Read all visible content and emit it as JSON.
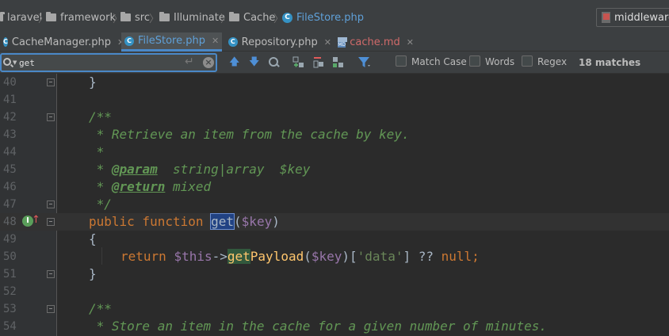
{
  "breadcrumbs": [
    {
      "label": "laravel",
      "icon": "folder-icon"
    },
    {
      "label": "framework",
      "icon": "folder-icon"
    },
    {
      "label": "src",
      "icon": "folder-icon"
    },
    {
      "label": "Illuminate",
      "icon": "folder-icon"
    },
    {
      "label": "Cache",
      "icon": "folder-icon"
    },
    {
      "label": "FileStore.php",
      "icon": "class-icon"
    }
  ],
  "run_config": {
    "label": "middleware"
  },
  "tabs": [
    {
      "label": "CacheManager.php",
      "active": false
    },
    {
      "label": "FileStore.php",
      "active": true
    },
    {
      "label": "Repository.php",
      "active": false
    },
    {
      "label": "cache.md",
      "active": false
    }
  ],
  "class_icon_letter": "C",
  "md_icon_text": "MD",
  "search": {
    "value": "get",
    "options": [
      {
        "label": "Match Case",
        "checked": false
      },
      {
        "label": "Words",
        "checked": false
      },
      {
        "label": "Regex",
        "checked": false
      }
    ],
    "matches": "18 matches",
    "icons": [
      "prev-occurrence-icon",
      "next-occurrence-icon",
      "find-all-icon",
      "add-selection-icon",
      "remove-selection-icon",
      "select-all-icon",
      "filter-icon"
    ]
  },
  "colors": {
    "keyword": "#cc7832",
    "doc_comment": "#629755",
    "variable": "#9876aa",
    "string": "#6a8759",
    "function": "#ffc66d",
    "search_highlight": "#214283",
    "active_tab": "#5fa0d8"
  },
  "editor": {
    "gutter_marker": {
      "line": "48",
      "icon": "implements-method-icon",
      "badge": "I",
      "arrow": "↑"
    },
    "lines": [
      {
        "num": "40",
        "t1": "    }"
      },
      {
        "num": "41",
        "t1": ""
      },
      {
        "num": "42",
        "t1": "/**"
      },
      {
        "num": "43",
        "t1": " * Retrieve an item from the cache by key."
      },
      {
        "num": "44",
        "t1": " *"
      },
      {
        "num": "45",
        "t1": " * ",
        "tag": "@param",
        "t2": "  string|array  $key"
      },
      {
        "num": "46",
        "t1": " * ",
        "tag": "@return",
        "t2": " mixed"
      },
      {
        "num": "47",
        "t1": " */"
      },
      {
        "num": "48",
        "kw": "public function ",
        "match": "get",
        "p1": "(",
        "var": "$key",
        "p2": ")"
      },
      {
        "num": "49",
        "t1": "{"
      },
      {
        "num": "50",
        "kw": "return ",
        "var": "$this",
        "p1": "->",
        "match": "get",
        "fn": "Payload",
        "p2": "(",
        "var2": "$key",
        "p3": ")[",
        "str": "'data'",
        "p4": "] ?? ",
        "kw2": "null",
        "p5": ";"
      },
      {
        "num": "51",
        "t1": "}"
      },
      {
        "num": "52",
        "t1": ""
      },
      {
        "num": "53",
        "t1": "/**"
      },
      {
        "num": "54",
        "t1": " * Store an item in the cache for a given number of minutes."
      }
    ]
  }
}
